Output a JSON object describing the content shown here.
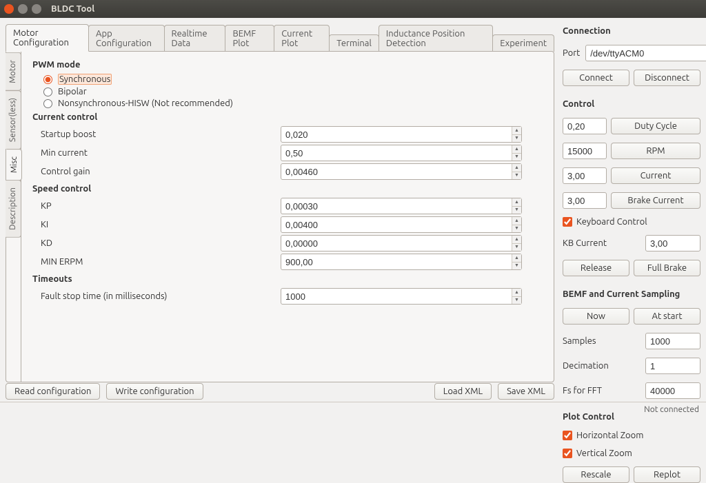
{
  "window": {
    "title": "BLDC Tool"
  },
  "tabs": {
    "top": [
      "Motor Configuration",
      "App Configuration",
      "Realtime Data",
      "BEMF Plot",
      "Current Plot",
      "Terminal",
      "Inductance Position Detection",
      "Experiment"
    ],
    "active": 0,
    "side": [
      "Motor",
      "Sensor(less)",
      "Misc",
      "Description"
    ],
    "side_active": 2
  },
  "pwm": {
    "title": "PWM mode",
    "options": [
      "Synchronous",
      "Bipolar",
      "Nonsynchronous-HISW (Not recommended)"
    ],
    "selected": 0
  },
  "current": {
    "title": "Current control",
    "startup_boost": {
      "label": "Startup boost",
      "value": "0,020"
    },
    "min_current": {
      "label": "Min current",
      "value": "0,50"
    },
    "control_gain": {
      "label": "Control gain",
      "value": "0,00460"
    }
  },
  "speed": {
    "title": "Speed control",
    "kp": {
      "label": "KP",
      "value": "0,00030"
    },
    "ki": {
      "label": "KI",
      "value": "0,00400"
    },
    "kd": {
      "label": "KD",
      "value": "0,00000"
    },
    "min_erpm": {
      "label": "MIN ERPM",
      "value": "900,00"
    }
  },
  "timeouts": {
    "title": "Timeouts",
    "fault_stop": {
      "label": "Fault stop time (in milliseconds)",
      "value": "1000"
    }
  },
  "bottom": {
    "read": "Read configuration",
    "write": "Write configuration",
    "load_xml": "Load XML",
    "save_xml": "Save XML"
  },
  "connection": {
    "title": "Connection",
    "port_label": "Port",
    "port_value": "/dev/ttyACM0",
    "connect": "Connect",
    "disconnect": "Disconnect"
  },
  "control": {
    "title": "Control",
    "duty_value": "0,20",
    "duty_btn": "Duty Cycle",
    "rpm_value": "15000",
    "rpm_btn": "RPM",
    "current_value": "3,00",
    "current_btn": "Current",
    "brake_value": "3,00",
    "brake_btn": "Brake Current",
    "kb_control": "Keyboard Control",
    "kb_curr_label": "KB Current",
    "kb_curr_value": "3,00",
    "release": "Release",
    "full_brake": "Full Brake"
  },
  "bemf": {
    "title": "BEMF and Current Sampling",
    "now": "Now",
    "at_start": "At start",
    "samples_label": "Samples",
    "samples_value": "1000",
    "decimation_label": "Decimation",
    "decimation_value": "1",
    "fs_label": "Fs for FFT",
    "fs_value": "40000"
  },
  "plot": {
    "title": "Plot Control",
    "hzoom": "Horizontal Zoom",
    "vzoom": "Vertical Zoom",
    "rescale": "Rescale",
    "replot": "Replot"
  },
  "status": {
    "text": "Not connected"
  }
}
